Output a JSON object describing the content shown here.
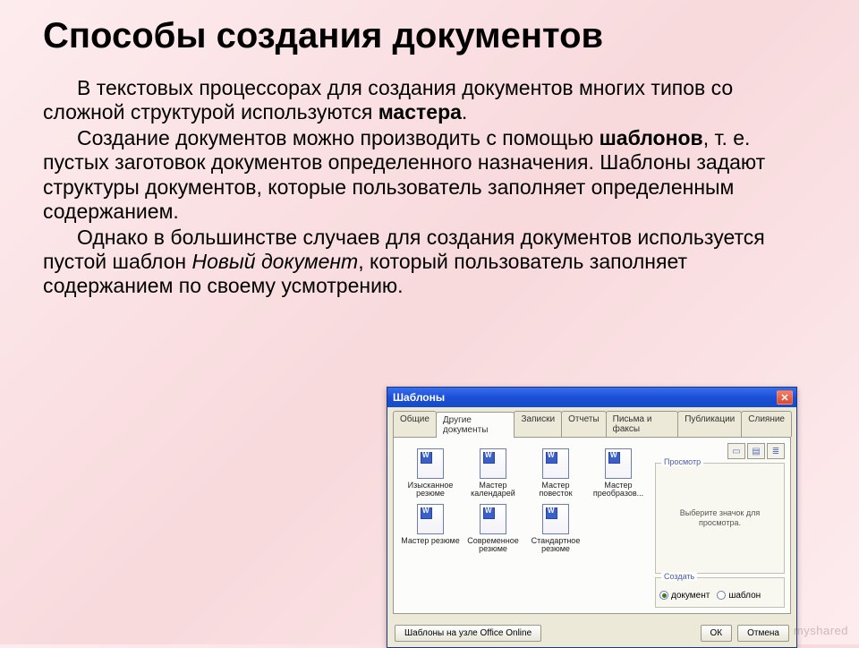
{
  "title": "Способы создания документов",
  "paragraphs": {
    "p1_a": "В текстовых процессорах для создания документов многих типов со сложной структурой используются ",
    "p1_b": "мастера",
    "p1_c": ".",
    "p2_a": "Создание документов можно производить с помощью ",
    "p2_b": "шаблонов",
    "p2_c": ", т. е. пустых заготовок документов определенного назначения. Шаблоны задают структуры документов, которые пользователь заполняет определенным содержанием.",
    "p3_a": "Однако в большинстве случаев для создания документов используется пустой шаблон ",
    "p3_b": "Новый документ",
    "p3_c": ", который пользователь заполняет содержанием по своему усмотрению."
  },
  "dialog": {
    "title": "Шаблоны",
    "tabs": [
      "Общие",
      "Другие документы",
      "Записки",
      "Отчеты",
      "Письма и факсы",
      "Публикации",
      "Слияние"
    ],
    "active_tab": 1,
    "templates": [
      "Изысканное резюме",
      "Мастер календарей",
      "Мастер повесток",
      "Мастер преобразов...",
      "Мастер резюме",
      "Современное резюме",
      "Стандартное резюме"
    ],
    "preview_label": "Просмотр",
    "preview_text": "Выберите значок для просмотра.",
    "create_label": "Создать",
    "radio_doc": "документ",
    "radio_tmpl": "шаблон",
    "footer_link": "Шаблоны на узле Office Online",
    "ok": "ОК",
    "cancel": "Отмена"
  },
  "watermark": "myshared"
}
